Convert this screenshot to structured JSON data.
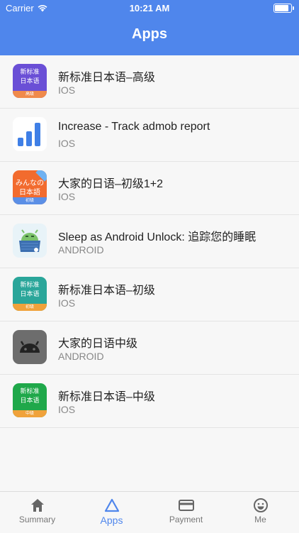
{
  "status_bar": {
    "carrier": "Carrier",
    "time": "10:21 AM",
    "battery_level": 0.95
  },
  "header": {
    "title": "Apps"
  },
  "apps": [
    {
      "title": "新标准日本语–高级",
      "platform": "IOS",
      "icon": "jp-advanced-icon",
      "icon_text": [
        "新标准",
        "日本语"
      ],
      "band": "高级",
      "color": "#6a4fd6",
      "band_color": "#f08a4b"
    },
    {
      "title": "Increase - Track admob report",
      "platform": "IOS",
      "icon": "bar-chart-icon"
    },
    {
      "title": "大家的日语–初级1+2",
      "platform": "IOS",
      "icon": "minna-icon",
      "icon_text": [
        "みんなの",
        "日本語"
      ],
      "band": "初级"
    },
    {
      "title": "Sleep as Android Unlock: 追踪您的睡眠",
      "platform": "ANDROID",
      "icon": "sleep-android-icon"
    },
    {
      "title": "新标准日本语–初级",
      "platform": "IOS",
      "icon": "jp-beginner-icon",
      "icon_text": [
        "新标准",
        "日本语"
      ],
      "band": "初级",
      "color": "#2aa69a",
      "band_color": "#f0a23b"
    },
    {
      "title": "大家的日语中级",
      "platform": "ANDROID",
      "icon": "android-robot-icon"
    },
    {
      "title": "新标准日本语–中级",
      "platform": "IOS",
      "icon": "jp-intermediate-icon",
      "icon_text": [
        "新标准",
        "日本语"
      ],
      "band": "中级",
      "color": "#1fa84a",
      "band_color": "#f0a23b"
    }
  ],
  "tabs": [
    {
      "label": "Summary",
      "icon": "home-icon"
    },
    {
      "label": "Apps",
      "icon": "triangle-icon",
      "active": true
    },
    {
      "label": "Payment",
      "icon": "card-icon"
    },
    {
      "label": "Me",
      "icon": "smiley-icon"
    }
  ],
  "colors": {
    "accent": "#4f86ec"
  }
}
